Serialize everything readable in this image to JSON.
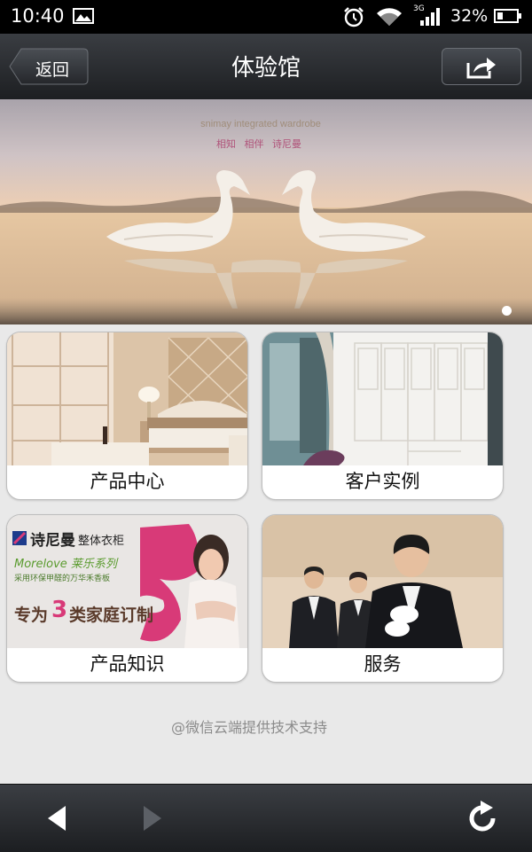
{
  "status": {
    "time": "10:40",
    "network": "3G",
    "battery": "32%",
    "battery_level": 0.32
  },
  "nav": {
    "back_label": "返回",
    "title": "体验馆"
  },
  "banner": {
    "subtitle_en": "snimay integrated wardrobe",
    "subtitle_cn": "相知 相伴 诗尼曼",
    "active_slide": 1,
    "slide_count": 1
  },
  "cards": [
    {
      "label": "产品中心"
    },
    {
      "label": "客户实例"
    },
    {
      "label": "产品知识",
      "image_text": {
        "brand": "诗尼曼",
        "brand_sub": "整体衣柜",
        "series": "Morelove 莱乐系列",
        "line2": "采用环保甲醛的万华禾香板",
        "slogan_pre": "专为",
        "slogan_num": "3",
        "slogan_post": "类家庭订制"
      }
    },
    {
      "label": "服务"
    }
  ],
  "footer": {
    "text": "@微信云端提供技术支持"
  },
  "icons": [
    "image-icon",
    "alarm-icon",
    "wifi-icon",
    "signal-icon",
    "battery-icon",
    "back-arrow-icon",
    "share-icon",
    "browser-back-icon",
    "browser-forward-icon",
    "refresh-icon"
  ]
}
